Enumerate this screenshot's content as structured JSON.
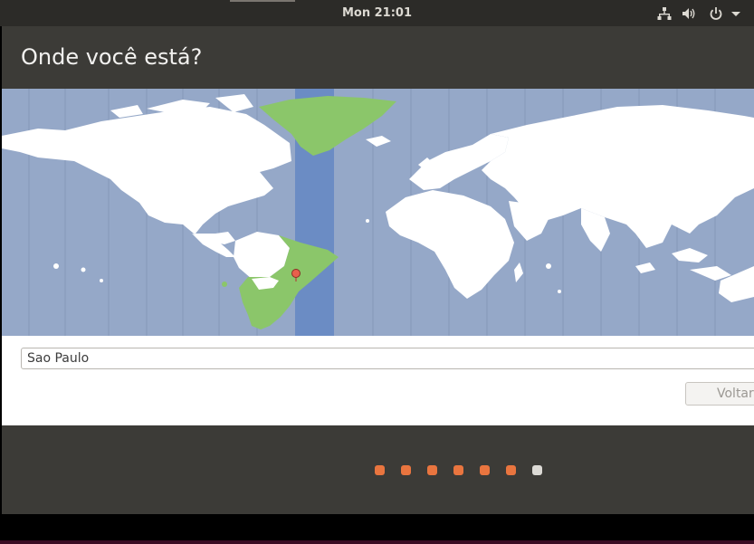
{
  "topbar": {
    "clock": "Mon 21:01",
    "icons": [
      "network-icon",
      "volume-icon",
      "power-icon",
      "menu-arrow-icon"
    ]
  },
  "window": {
    "title": "Onde você está?"
  },
  "location": {
    "value": "Sao Paulo",
    "selected_timezone_color": "#6b8cc4",
    "selected_country_color": "#8bc66a",
    "map_water_color": "#95a8c8",
    "land_color": "#ffffff",
    "marker_color": "#e8604c"
  },
  "buttons": {
    "back_label": "Voltar"
  },
  "progress": {
    "total_steps": 7,
    "current_step": 7,
    "done_color": "#e9753f",
    "current_color": "#dcdad5"
  }
}
